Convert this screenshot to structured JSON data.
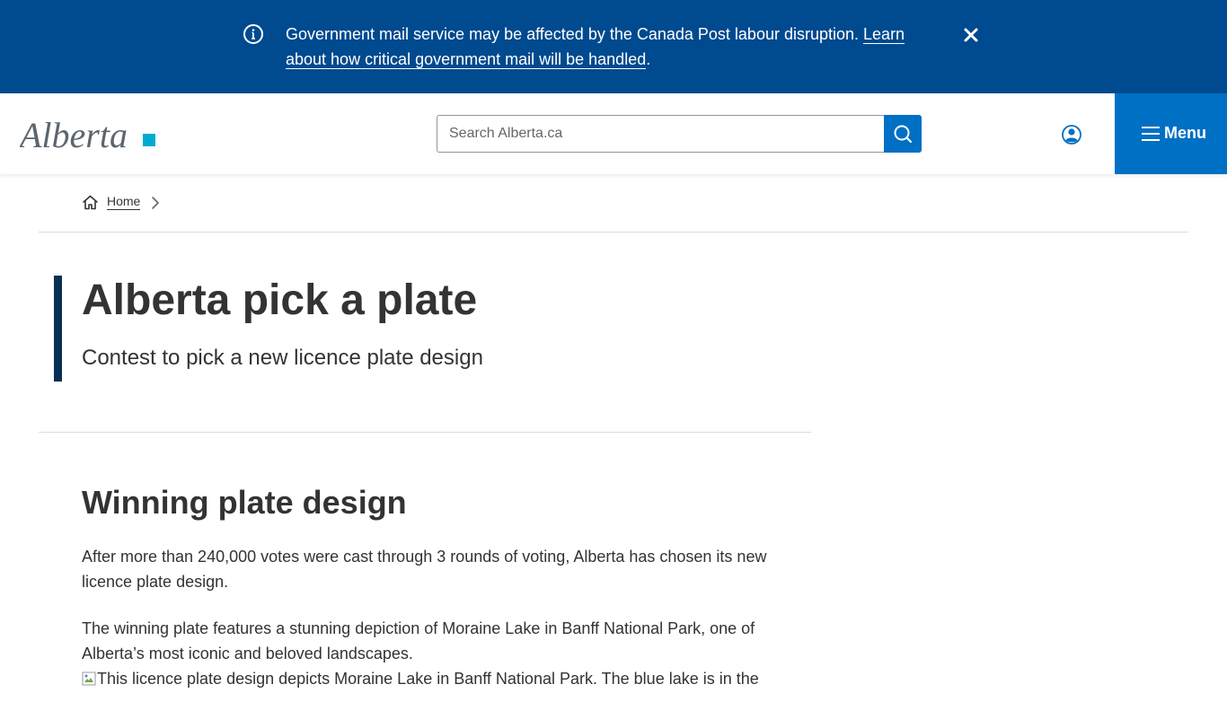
{
  "alert": {
    "message": "Government mail service may be affected by the Canada Post labour disruption.",
    "link_text": "Learn about how critical government mail will be handled",
    "trailing": ".",
    "info_icon": "info-circle-icon",
    "close_icon": "close-x-icon"
  },
  "header": {
    "logo_text": "Alberta",
    "search": {
      "placeholder": "Search Alberta.ca",
      "value": ""
    },
    "search_icon": "magnifier-icon",
    "account_icon": "user-circle-icon",
    "menu_label": "Menu",
    "menu_icon": "hamburger-icon"
  },
  "breadcrumb": {
    "home_label": "Home",
    "home_icon": "house-icon",
    "separator_icon": "chevron-right-icon"
  },
  "hero": {
    "title": "Alberta pick a plate",
    "subtitle": "Contest to pick a new licence plate design"
  },
  "content": {
    "heading": "Winning plate design",
    "paragraph_1": "After more than 240,000 votes were cast through 3 rounds of voting, Alberta has chosen its new licence plate design.",
    "paragraph_2": "The winning plate features a stunning depiction of Moraine Lake in Banff National Park, one of Alberta’s most iconic and beloved landscapes.",
    "image_alt": "This licence plate design depicts Moraine Lake in Banff National Park. The blue lake is in the"
  },
  "colors": {
    "alert_bg": "#004a8f",
    "brand_blue": "#0070c4",
    "hero_bar": "#0a2f55",
    "logo_teal": "#00aad2"
  }
}
